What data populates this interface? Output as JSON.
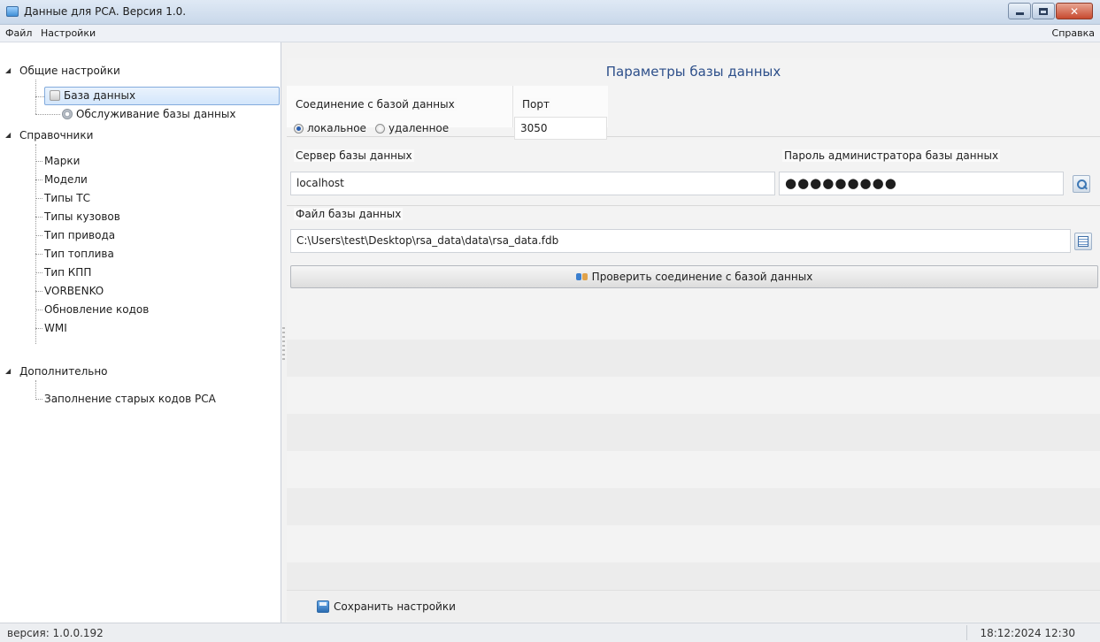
{
  "window": {
    "title": "Данные для РСА. Версия 1.0.",
    "controls": {
      "minimize": "minimize",
      "maximize": "maximize",
      "close": "✕"
    }
  },
  "menu": {
    "file": "Файл",
    "settings": "Настройки",
    "help": "Справка"
  },
  "tree": {
    "general": {
      "label": "Общие настройки",
      "items": [
        "База данных",
        "Обслуживание базы данных"
      ]
    },
    "directories": {
      "label": "Справочники",
      "items": [
        "Марки",
        "Модели",
        "Типы ТС",
        "Типы кузовов",
        "Тип привода",
        "Тип топлива",
        "Тип КПП",
        "VORBENKO",
        "Обновление кодов",
        "WMI"
      ]
    },
    "additional": {
      "label": "Дополнительно",
      "items": [
        "Заполнение старых кодов РСА"
      ]
    },
    "selected": "База данных"
  },
  "panel": {
    "title": "Параметры базы данных",
    "connection": {
      "label": "Соединение с базой данных",
      "options": [
        "локальное",
        "удаленное"
      ],
      "selected": "локальное"
    },
    "port": {
      "label": "Порт",
      "value": "3050"
    },
    "server": {
      "label": "Сервер базы данных",
      "value": "localhost"
    },
    "admin_password": {
      "label": "Пароль администратора базы данных",
      "value": "●●●●●●●●●"
    },
    "db_file": {
      "label": "Файл базы данных",
      "value": "C:\\Users\\test\\Desktop\\rsa_data\\data\\rsa_data.fdb"
    },
    "check_button": "Проверить соединение с базой данных",
    "save_button": "Сохранить настройки"
  },
  "status": {
    "version": "версия: 1.0.0.192",
    "datetime": "18:12:2024 12:30"
  },
  "icons": {
    "app": "app-icon",
    "db_node": "database-icon",
    "maintenance_node": "gear-icon",
    "password_lookup": "search-icon",
    "file_browse": "folder-icon",
    "check": "link-icon",
    "save": "save-icon"
  },
  "colors": {
    "title_blue": "#2d4f8a",
    "selection": "#d3e6fb",
    "close_red": "#c74a2f"
  }
}
